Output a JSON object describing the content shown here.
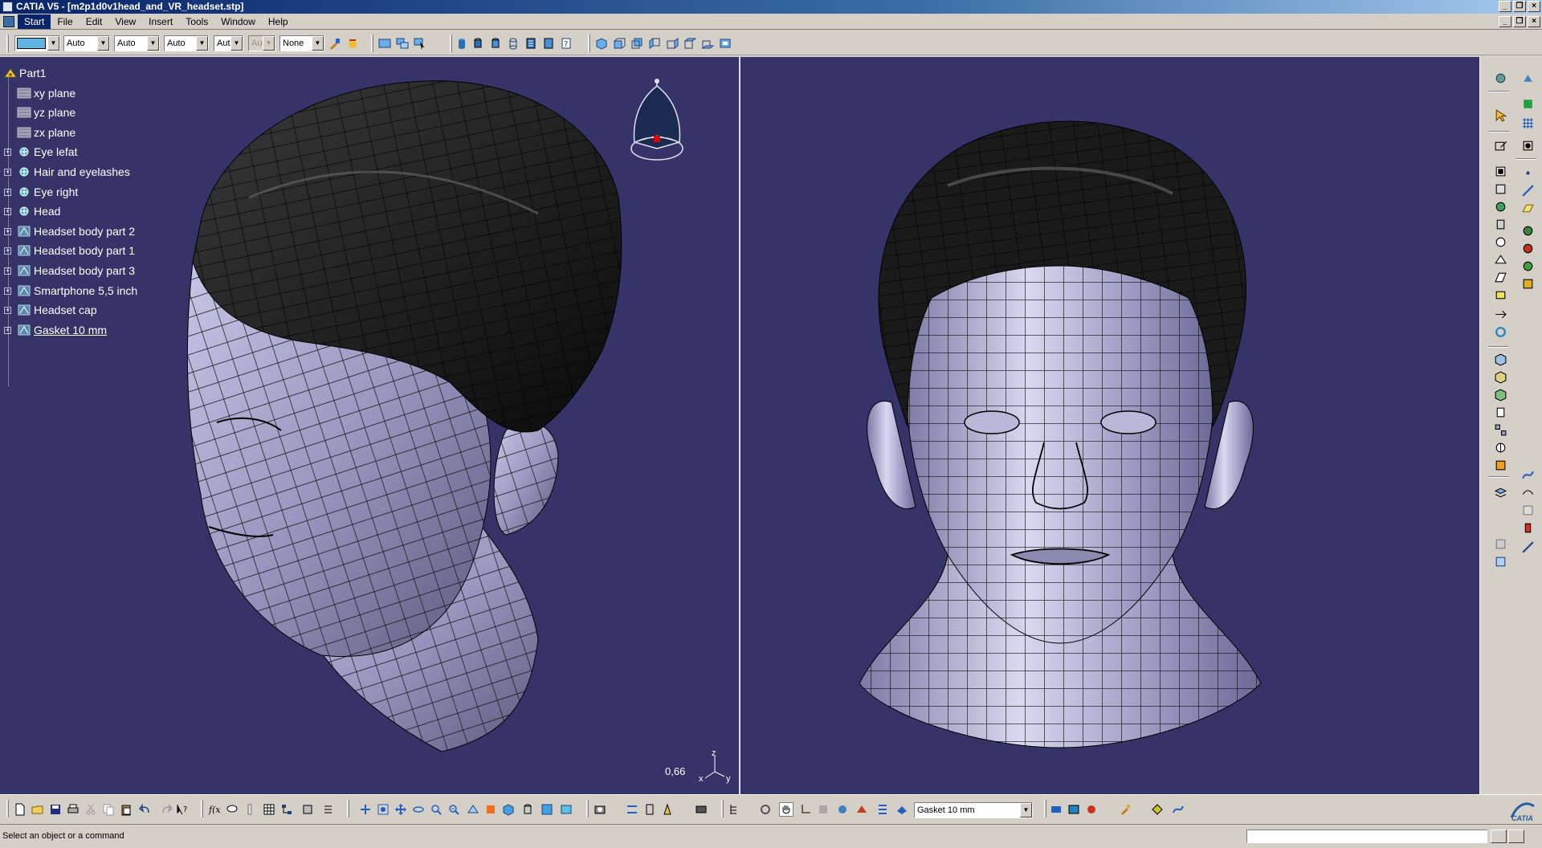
{
  "window": {
    "title": "CATIA V5 - [m2p1d0v1head_and_VR_headset.stp]"
  },
  "menu": {
    "items": [
      {
        "label": "Start",
        "active": true
      },
      {
        "label": "File"
      },
      {
        "label": "Edit"
      },
      {
        "label": "View"
      },
      {
        "label": "Insert"
      },
      {
        "label": "Tools"
      },
      {
        "label": "Window"
      },
      {
        "label": "Help"
      }
    ]
  },
  "graphic_properties": {
    "color_swatch": "#5fb4e0",
    "linetype": "Auto",
    "thickness": "Auto",
    "pointtype": "Auto",
    "layer_short": "Aut",
    "layer_disabled": "Aut",
    "style": "None"
  },
  "tree": {
    "root": "Part1",
    "nodes": [
      {
        "label": "xy plane",
        "icon": "plane-icon",
        "expandable": false
      },
      {
        "label": "yz plane",
        "icon": "plane-icon",
        "expandable": false
      },
      {
        "label": "zx plane",
        "icon": "plane-icon",
        "expandable": false
      },
      {
        "label": "Eye lefat",
        "icon": "geometrical-set-icon",
        "expandable": true
      },
      {
        "label": "Hair and eyelashes",
        "icon": "geometrical-set-icon",
        "expandable": true
      },
      {
        "label": "Eye right",
        "icon": "geometrical-set-icon",
        "expandable": true
      },
      {
        "label": "Head",
        "icon": "geometrical-set-icon",
        "expandable": true
      },
      {
        "label": "Headset body part 2",
        "icon": "body-icon",
        "expandable": true
      },
      {
        "label": "Headset body part 1",
        "icon": "body-icon",
        "expandable": true
      },
      {
        "label": "Headset body part 3",
        "icon": "body-icon",
        "expandable": true
      },
      {
        "label": "Smartphone 5,5 inch",
        "icon": "body-icon",
        "expandable": true
      },
      {
        "label": "Headset cap",
        "icon": "body-icon",
        "expandable": true
      },
      {
        "label": "Gasket 10 mm",
        "icon": "body-icon",
        "expandable": true,
        "current": true
      }
    ]
  },
  "viewport": {
    "background": "#343469",
    "zoom_readout": "0,66",
    "axis_labels": {
      "z": "z",
      "x": "x",
      "y": "y"
    }
  },
  "bottom_toolbar": {
    "current_body": "Gasket 10 mm"
  },
  "status": {
    "message": "Select an object or a command",
    "command_input": ""
  }
}
